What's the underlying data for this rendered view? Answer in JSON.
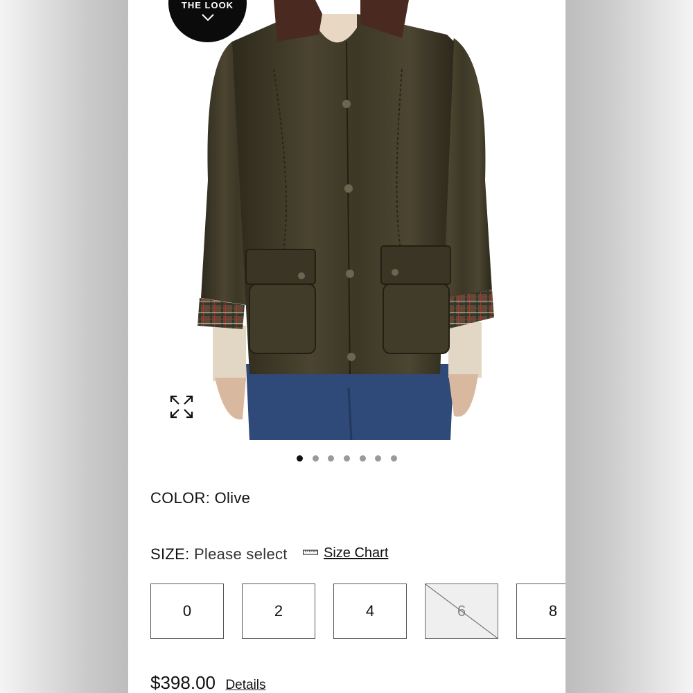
{
  "badge": {
    "label": "THE LOOK"
  },
  "product": {
    "color_label": "COLOR:",
    "color_value": "Olive",
    "size_label": "SIZE:",
    "size_value": "Please select",
    "size_chart_label": "Size Chart",
    "sizes": [
      {
        "label": "0",
        "available": true
      },
      {
        "label": "2",
        "available": true
      },
      {
        "label": "4",
        "available": true
      },
      {
        "label": "6",
        "available": false
      },
      {
        "label": "8",
        "available": true
      }
    ],
    "price": "$398.00",
    "details_label": "Details"
  },
  "carousel": {
    "total": 7,
    "active_index": 0
  },
  "colors": {
    "badge_bg": "#0b0b0b",
    "accent": "#111111",
    "disabled_bg": "#efefef"
  },
  "icons": {
    "expand": "expand-icon",
    "ruler": "ruler-icon",
    "chevron": "chevron-down-icon"
  }
}
